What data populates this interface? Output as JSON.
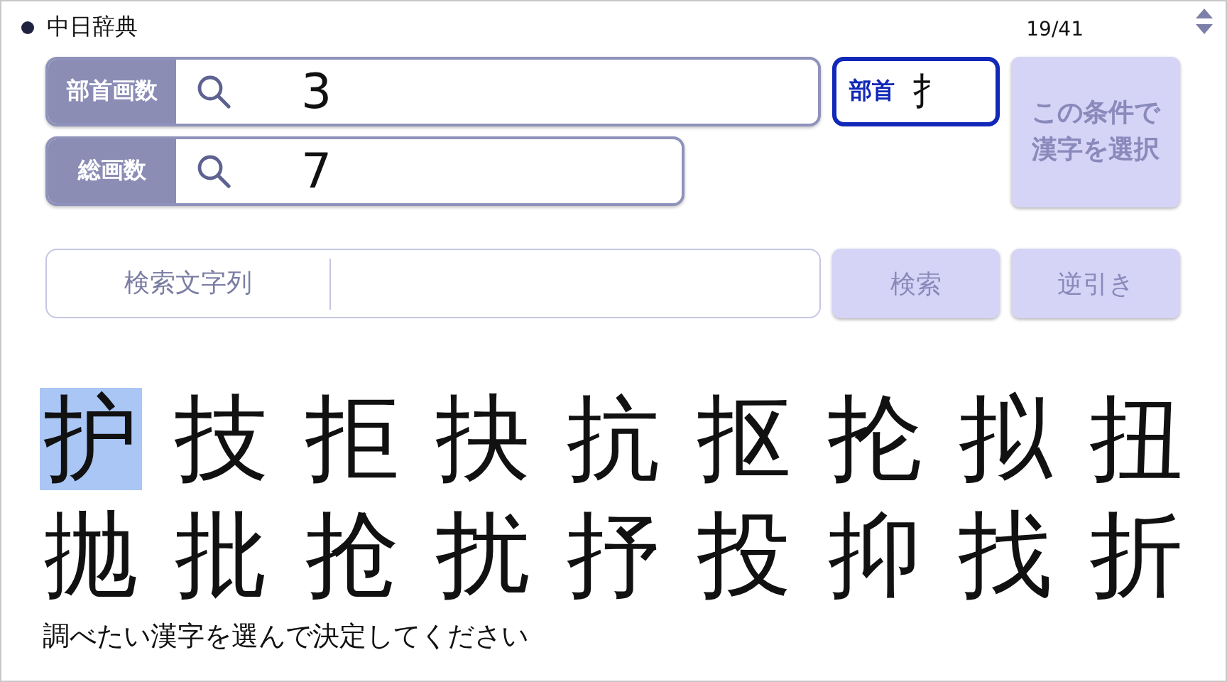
{
  "header": {
    "title": "中日辞典",
    "page": "19/41"
  },
  "stroke_fields": [
    {
      "label": "部首画数",
      "value": "3"
    },
    {
      "label": "総画数",
      "value": "7"
    }
  ],
  "radical": {
    "label": "部首",
    "value": "扌",
    "selected": true
  },
  "select_button": {
    "lines": [
      "この条件で",
      "漢字を選択"
    ],
    "disabled": true
  },
  "search": {
    "label": "検索文字列"
  },
  "buttons": [
    {
      "label": "検索",
      "disabled": true
    },
    {
      "label": "逆引き",
      "disabled": true
    }
  ],
  "kanji": [
    {
      "char": "护",
      "selected": true
    },
    {
      "char": "技",
      "selected": false
    },
    {
      "char": "拒",
      "selected": false
    },
    {
      "char": "抉",
      "selected": false
    },
    {
      "char": "抗",
      "selected": false
    },
    {
      "char": "抠",
      "selected": false
    },
    {
      "char": "抡",
      "selected": false
    },
    {
      "char": "拟",
      "selected": false
    },
    {
      "char": "扭",
      "selected": false
    },
    {
      "char": "抛",
      "selected": false
    },
    {
      "char": "批",
      "selected": false
    },
    {
      "char": "抢",
      "selected": false
    },
    {
      "char": "扰",
      "selected": false
    },
    {
      "char": "抒",
      "selected": false
    },
    {
      "char": "投",
      "selected": false
    },
    {
      "char": "抑",
      "selected": false
    },
    {
      "char": "找",
      "selected": false
    },
    {
      "char": "折",
      "selected": false
    }
  ],
  "prompt": "調べたい漢字を選んで決定してください"
}
